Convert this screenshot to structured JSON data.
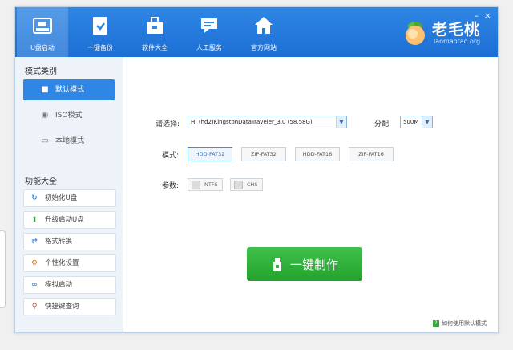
{
  "toolbar": {
    "items": [
      {
        "label": "U盘启动",
        "icon": "usb-boot-icon"
      },
      {
        "label": "一键备份",
        "icon": "backup-icon"
      },
      {
        "label": "软件大全",
        "icon": "software-icon"
      },
      {
        "label": "人工服务",
        "icon": "chat-support-icon"
      },
      {
        "label": "官方网站",
        "icon": "home-icon"
      }
    ],
    "active_index": 0
  },
  "window_controls": {
    "minimize": "–",
    "close": "×"
  },
  "logo": {
    "brand": "老毛桃",
    "url": "laomaotao.org"
  },
  "sidebar": {
    "mode_section_title": "模式类别",
    "modes": [
      {
        "label": "默认模式",
        "icon": "user-icon",
        "active": true
      },
      {
        "label": "ISO模式",
        "icon": "disc-icon",
        "active": false
      },
      {
        "label": "本地模式",
        "icon": "monitor-icon",
        "active": false
      }
    ],
    "function_section_title": "功能大全",
    "functions": [
      {
        "label": "初始化U盘",
        "icon": "refresh-icon"
      },
      {
        "label": "升级启动U盘",
        "icon": "arrow-up-icon"
      },
      {
        "label": "格式转换",
        "icon": "convert-icon"
      },
      {
        "label": "个性化设置",
        "icon": "gear-icon"
      },
      {
        "label": "模拟启动",
        "icon": "link-icon"
      },
      {
        "label": "快捷键查询",
        "icon": "search-icon"
      }
    ]
  },
  "main": {
    "device_label": "请选择:",
    "device_value": "H: (hd2)KingstonDataTraveler_3.0 (58.58G)",
    "alloc_label": "分配:",
    "alloc_value": "500M",
    "mode_label": "模式:",
    "mode_options": [
      "HDD-FAT32",
      "ZIP-FAT32",
      "HDD-FAT16",
      "ZIP-FAT16"
    ],
    "mode_selected": 0,
    "params_label": "参数:",
    "params": [
      {
        "label": "NTFS",
        "checked": false
      },
      {
        "label": "CHS",
        "checked": false
      }
    ],
    "make_button": "一键制作",
    "help_link": "如何使用默认模式"
  },
  "colors": {
    "header_blue": "#2383e2",
    "active_blue": "#2f86e5",
    "make_green": "#2eb339"
  }
}
